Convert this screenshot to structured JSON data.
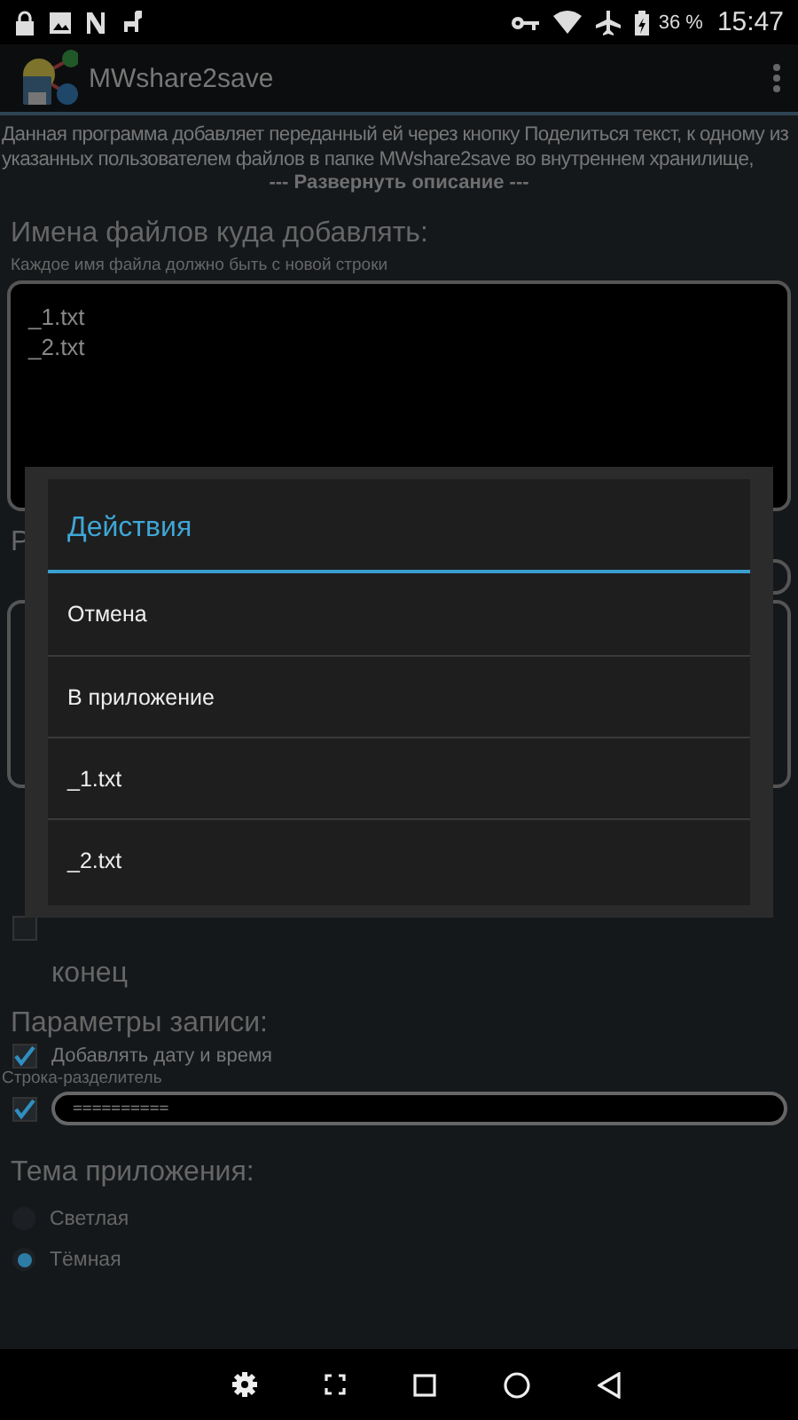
{
  "status_bar": {
    "battery": "36 %",
    "time": "15:47"
  },
  "app_bar": {
    "title": "MWshare2save"
  },
  "description": {
    "text": "Данная программа добавляет переданный ей через кнопку Поделиться текст, к одному из указанных пользователем файлов в папке MWshare2save во внутреннем хранилище,",
    "expand_link": "--- Развернуть описание ---"
  },
  "files_section": {
    "title": "Имена файлов куда добавлять:",
    "hint": "Каждое имя файла должно быть с новой строки",
    "value": "_1.txt\n_2.txt"
  },
  "hidden_section": {
    "label": "Р",
    "checkbox_text": "конец",
    "checked": false
  },
  "write_params": {
    "title": "Параметры записи:",
    "add_datetime": {
      "label": "Добавлять дату и время",
      "checked": true
    },
    "separator_label": "Строка-разделитель",
    "separator": {
      "checked": true,
      "value": "=========="
    }
  },
  "theme": {
    "title": "Тема приложения:",
    "options": [
      {
        "label": "Светлая",
        "selected": false
      },
      {
        "label": "Тёмная",
        "selected": true
      }
    ]
  },
  "dialog": {
    "title": "Действия",
    "items": [
      "Отмена",
      "В приложение",
      "_1.txt",
      "_2.txt"
    ]
  }
}
